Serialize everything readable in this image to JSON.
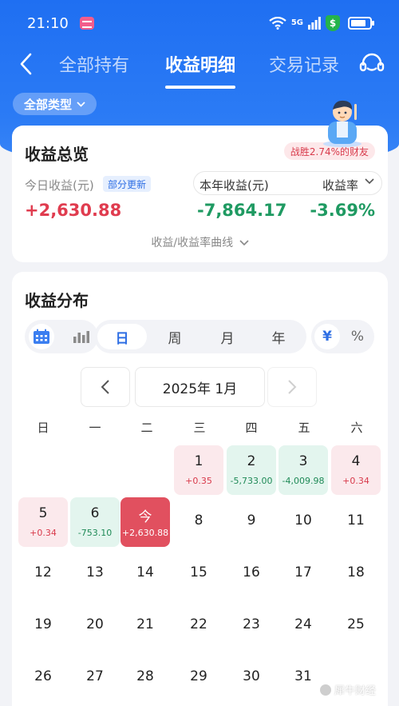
{
  "status_bar": {
    "time": "21:10",
    "network": "5G"
  },
  "nav": {
    "tabs": [
      {
        "label": "全部持有"
      },
      {
        "label": "收益明细"
      },
      {
        "label": "交易记录"
      }
    ]
  },
  "filter": {
    "label": "全部类型"
  },
  "overview": {
    "title": "收益总览",
    "win_badge": "战胜2.74%的财友",
    "today_label": "今日收益(元)",
    "partial_badge": "部分更新",
    "today_value": "+2,630.88",
    "year_label": "本年收益(元)",
    "year_value": "-7,864.17",
    "rate_label": "收益率",
    "rate_value": "-3.69%",
    "curve_link": "收益/收益率曲线"
  },
  "distribution": {
    "title": "收益分布",
    "periods": [
      "日",
      "周",
      "月",
      "年"
    ],
    "units": [
      "¥",
      "%"
    ],
    "month_label": "2025年 1月",
    "weekdays": [
      "日",
      "一",
      "二",
      "三",
      "四",
      "五",
      "六"
    ],
    "days": [
      {
        "num": "1",
        "pl": "+0.35",
        "kind": "gain"
      },
      {
        "num": "2",
        "pl": "-5,733.00",
        "kind": "loss"
      },
      {
        "num": "3",
        "pl": "-4,009.98",
        "kind": "loss"
      },
      {
        "num": "4",
        "pl": "+0.34",
        "kind": "gain"
      },
      {
        "num": "5",
        "pl": "+0.34",
        "kind": "gain"
      },
      {
        "num": "6",
        "pl": "-753.10",
        "kind": "loss"
      },
      {
        "num": "今",
        "pl": "+2,630.88",
        "kind": "today"
      },
      {
        "num": "8",
        "pl": "",
        "kind": "plain"
      },
      {
        "num": "9",
        "pl": "",
        "kind": "plain"
      },
      {
        "num": "10",
        "pl": "",
        "kind": "plain"
      },
      {
        "num": "11",
        "pl": "",
        "kind": "plain"
      },
      {
        "num": "12",
        "pl": "",
        "kind": "plain"
      },
      {
        "num": "13",
        "pl": "",
        "kind": "plain"
      },
      {
        "num": "14",
        "pl": "",
        "kind": "plain"
      },
      {
        "num": "15",
        "pl": "",
        "kind": "plain"
      },
      {
        "num": "16",
        "pl": "",
        "kind": "plain"
      },
      {
        "num": "17",
        "pl": "",
        "kind": "plain"
      },
      {
        "num": "18",
        "pl": "",
        "kind": "plain"
      },
      {
        "num": "19",
        "pl": "",
        "kind": "plain"
      },
      {
        "num": "20",
        "pl": "",
        "kind": "plain"
      },
      {
        "num": "21",
        "pl": "",
        "kind": "plain"
      },
      {
        "num": "22",
        "pl": "",
        "kind": "plain"
      },
      {
        "num": "23",
        "pl": "",
        "kind": "plain"
      },
      {
        "num": "24",
        "pl": "",
        "kind": "plain"
      },
      {
        "num": "25",
        "pl": "",
        "kind": "plain"
      },
      {
        "num": "26",
        "pl": "",
        "kind": "plain"
      },
      {
        "num": "27",
        "pl": "",
        "kind": "plain"
      },
      {
        "num": "28",
        "pl": "",
        "kind": "plain"
      },
      {
        "num": "29",
        "pl": "",
        "kind": "plain"
      },
      {
        "num": "30",
        "pl": "",
        "kind": "plain"
      },
      {
        "num": "31",
        "pl": "",
        "kind": "plain"
      }
    ]
  },
  "watermark": "犀牛财经",
  "colors": {
    "brand_blue": "#1f6ff2",
    "gain_red": "#e03c4f",
    "loss_green": "#1f9a62"
  },
  "icons": [
    "back-icon",
    "customer-service-icon",
    "calendar-icon",
    "bar-chart-icon",
    "chevron-left-icon",
    "chevron-right-icon",
    "chevron-down-icon"
  ]
}
